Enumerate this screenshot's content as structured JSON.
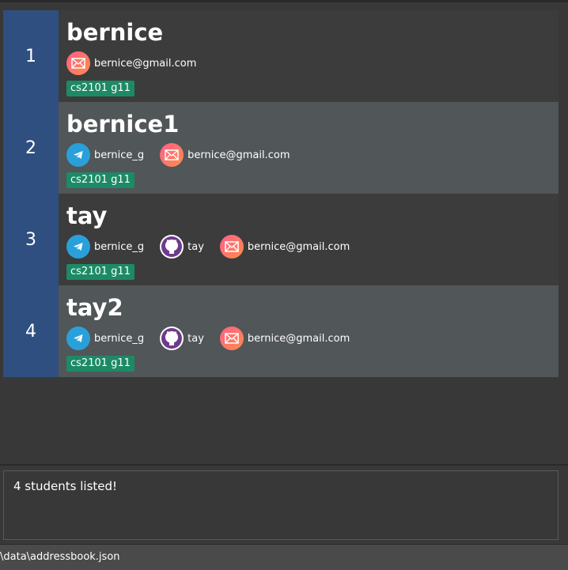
{
  "persons": [
    {
      "index": "1",
      "name": "bernice",
      "contacts": [
        {
          "type": "email",
          "icon": "email-icon",
          "value": "bernice@gmail.com"
        }
      ],
      "tag": "cs2101 g11"
    },
    {
      "index": "2",
      "name": "bernice1",
      "contacts": [
        {
          "type": "telegram",
          "icon": "telegram-icon",
          "value": "bernice_g"
        },
        {
          "type": "email",
          "icon": "email-icon",
          "value": "bernice@gmail.com"
        }
      ],
      "tag": "cs2101 g11"
    },
    {
      "index": "3",
      "name": "tay",
      "contacts": [
        {
          "type": "telegram",
          "icon": "telegram-icon",
          "value": "bernice_g"
        },
        {
          "type": "github",
          "icon": "github-icon",
          "value": "tay"
        },
        {
          "type": "email",
          "icon": "email-icon",
          "value": "bernice@gmail.com"
        }
      ],
      "tag": "cs2101 g11"
    },
    {
      "index": "4",
      "name": "tay2",
      "contacts": [
        {
          "type": "telegram",
          "icon": "telegram-icon",
          "value": "bernice_g"
        },
        {
          "type": "github",
          "icon": "github-icon",
          "value": "tay"
        },
        {
          "type": "email",
          "icon": "email-icon",
          "value": "bernice@gmail.com"
        }
      ],
      "tag": "cs2101 g11"
    }
  ],
  "result": {
    "message": "4 students listed!"
  },
  "status_bar": {
    "file_path": "\\data\\addressbook.json"
  },
  "colors": {
    "index_cell": "#2e4f7f",
    "tag": "#1d8a66",
    "card_odd": "#3c3c3c",
    "card_even": "#515658"
  }
}
